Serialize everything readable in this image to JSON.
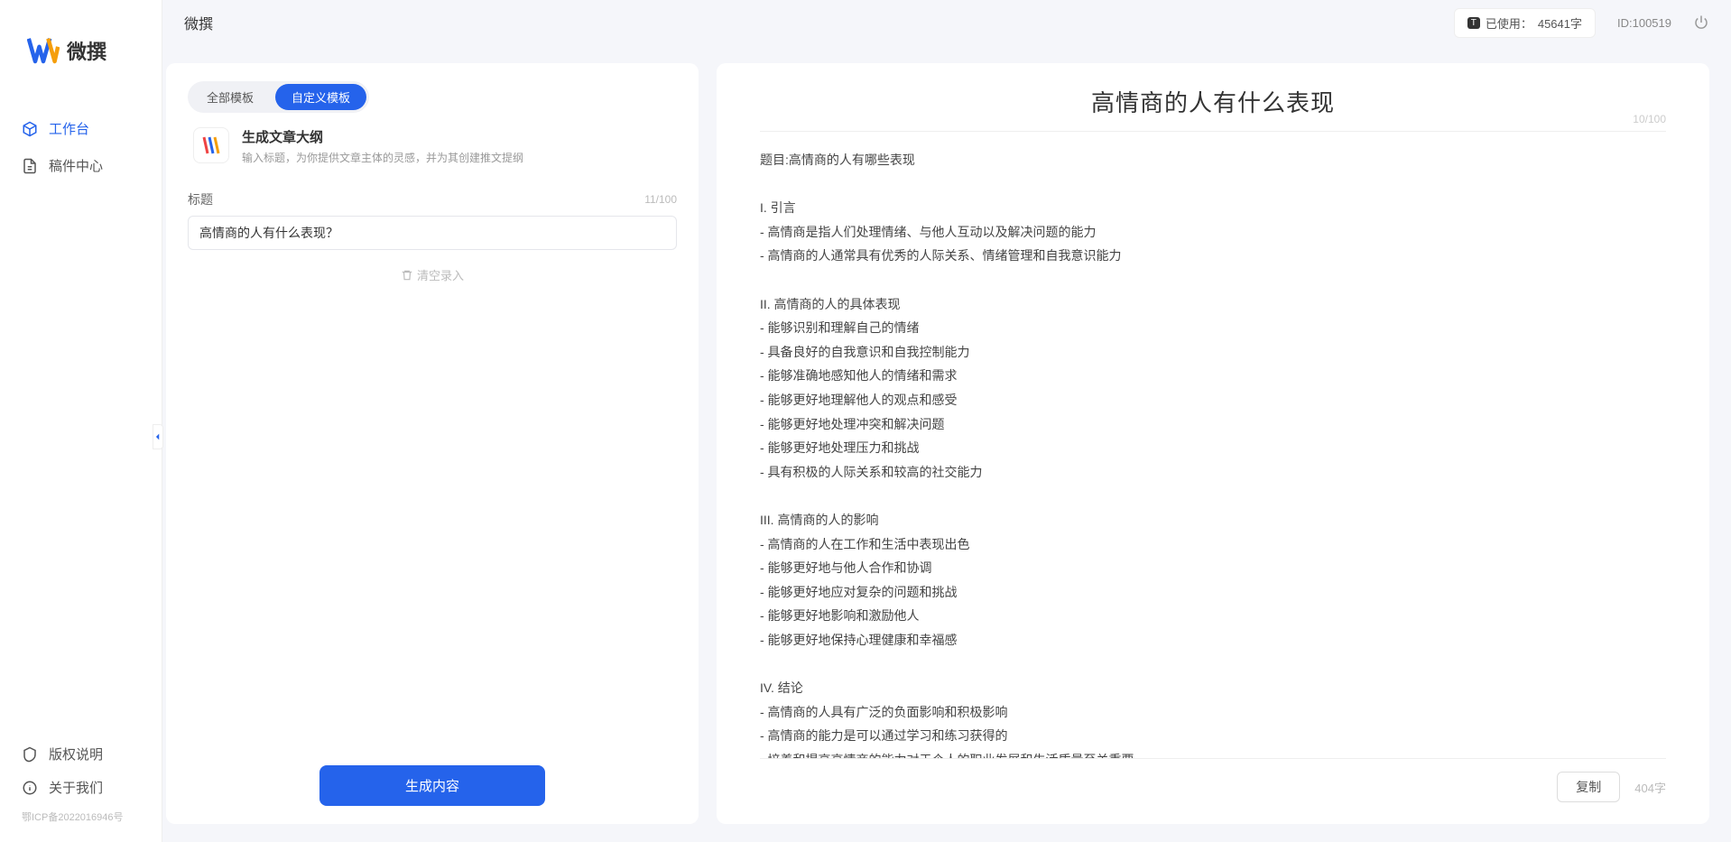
{
  "app": {
    "name": "微撰"
  },
  "sidebar": {
    "logo_text": "微撰",
    "nav": [
      {
        "label": "工作台",
        "active": true
      },
      {
        "label": "稿件中心",
        "active": false
      }
    ],
    "footer": [
      {
        "label": "版权说明"
      },
      {
        "label": "关于我们"
      }
    ],
    "icp": "鄂ICP备2022016946号"
  },
  "topbar": {
    "title": "微撰",
    "usage_prefix": "已使用：",
    "usage_value": "45641字",
    "user_id": "ID:100519"
  },
  "tabs": [
    {
      "label": "全部模板",
      "active": false
    },
    {
      "label": "自定义模板",
      "active": true
    }
  ],
  "template": {
    "title": "生成文章大纲",
    "desc": "输入标题，为你提供文章主体的灵感，并为其创建推文提纲"
  },
  "form": {
    "label": "标题",
    "char_count": "11/100",
    "value": "高情商的人有什么表现？",
    "clear_label": "清空录入"
  },
  "generate_label": "生成内容",
  "output": {
    "title": "高情商的人有什么表现",
    "header_count": "10/100",
    "body": "题目:高情商的人有哪些表现\n\nI. 引言\n- 高情商是指人们处理情绪、与他人互动以及解决问题的能力\n- 高情商的人通常具有优秀的人际关系、情绪管理和自我意识能力\n\nII. 高情商的人的具体表现\n- 能够识别和理解自己的情绪\n- 具备良好的自我意识和自我控制能力\n- 能够准确地感知他人的情绪和需求\n- 能够更好地理解他人的观点和感受\n- 能够更好地处理冲突和解决问题\n- 能够更好地处理压力和挑战\n- 具有积极的人际关系和较高的社交能力\n\nIII. 高情商的人的影响\n- 高情商的人在工作和生活中表现出色\n- 能够更好地与他人合作和协调\n- 能够更好地应对复杂的问题和挑战\n- 能够更好地影响和激励他人\n- 能够更好地保持心理健康和幸福感\n\nIV. 结论\n- 高情商的人具有广泛的负面影响和积极影响\n- 高情商的能力是可以通过学习和练习获得的\n- 培养和提高高情商的能力对于个人的职业发展和生活质量至关重要。",
    "copy_label": "复制",
    "word_count": "404字"
  }
}
